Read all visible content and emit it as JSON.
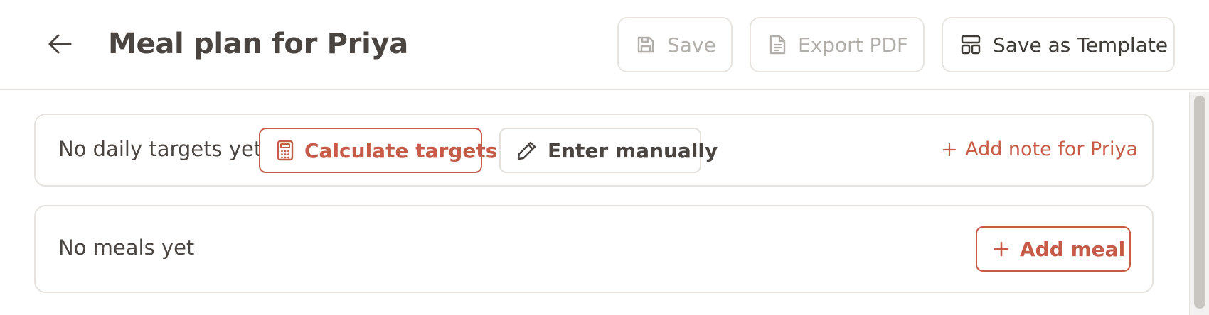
{
  "header": {
    "title": "Meal plan for Priya",
    "back_icon": "arrow-left-icon",
    "buttons": {
      "save": {
        "label": "Save",
        "icon": "floppy-disk-icon",
        "state": "disabled"
      },
      "export": {
        "label": "Export PDF",
        "icon": "document-icon",
        "state": "disabled"
      },
      "template": {
        "label": "Save as Template",
        "icon": "layout-template-icon",
        "state": "enabled"
      }
    }
  },
  "targets": {
    "empty_text": "No daily targets yet",
    "calculate": {
      "label": "Calculate targets",
      "icon": "calculator-icon"
    },
    "manual": {
      "label": "Enter manually",
      "icon": "pencil-icon"
    },
    "add_note": {
      "label": "Add note for Priya",
      "icon": "plus-icon"
    }
  },
  "meals": {
    "empty_text": "No meals yet",
    "add_meal": {
      "label": "Add meal",
      "icon": "plus-icon"
    }
  },
  "colors": {
    "accent": "#c65b47",
    "text": "#4a4541",
    "disabled": "#b2aea9",
    "border": "#e6e3df"
  }
}
